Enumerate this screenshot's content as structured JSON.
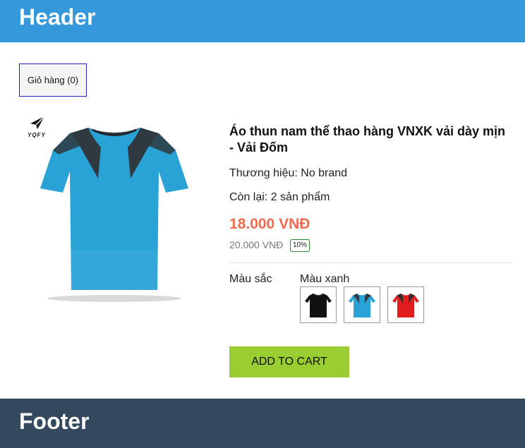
{
  "header": {
    "title": "Header"
  },
  "footer": {
    "title": "Footer"
  },
  "cart": {
    "label": "Giỏ hàng (0)"
  },
  "product": {
    "title": "Áo thun nam thể thao hàng VNXK vải dày mịn - Vải Đốm",
    "brand": "Thương hiệu: No brand",
    "stock": "Còn lại: 2 sản phẩm",
    "price": "18.000 VNĐ",
    "old_price": "20.000 VNĐ",
    "discount": "10%",
    "logo_text": "YQFY",
    "image_color": "#29a3d6"
  },
  "colors": {
    "label": "Màu sắc",
    "selected": "Màu xanh",
    "options": [
      {
        "name": "black",
        "hex": "#111111"
      },
      {
        "name": "blue",
        "hex": "#29a3d6"
      },
      {
        "name": "red",
        "hex": "#e01e1e"
      }
    ]
  },
  "actions": {
    "add_to_cart": "ADD TO CART"
  }
}
